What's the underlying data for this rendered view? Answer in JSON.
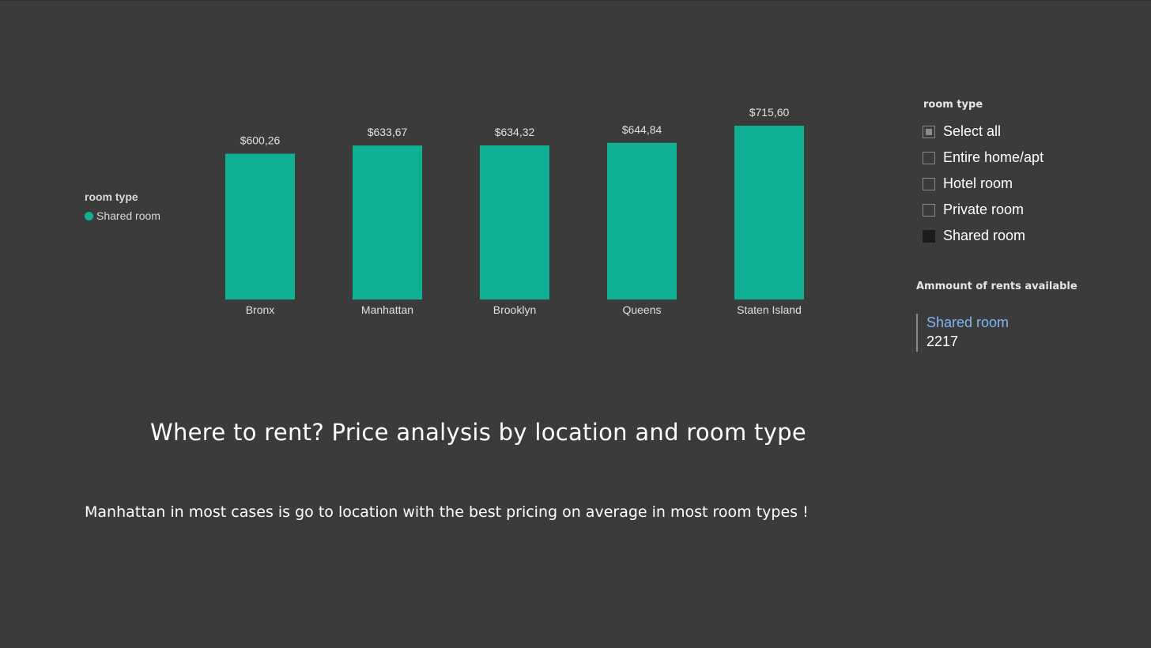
{
  "report": {
    "title": "Where to rent? Price analysis by location and room type",
    "note": "Manhattan in most cases is go to location with the best pricing on average in most room types !"
  },
  "legend": {
    "title": "room type",
    "item": "Shared room",
    "color": "#10b095"
  },
  "chart_data": {
    "type": "bar",
    "categories": [
      "Bronx",
      "Manhattan",
      "Brooklyn",
      "Queens",
      "Staten Island"
    ],
    "series": [
      {
        "name": "Shared room",
        "values": [
          600.26,
          633.67,
          634.32,
          644.84,
          715.6
        ],
        "labels": [
          "$600,26",
          "$633,67",
          "$634,32",
          "$644,84",
          "$715,60"
        ],
        "color": "#10b095"
      }
    ],
    "grid": false,
    "legend_position": "left"
  },
  "slicer": {
    "title": "room type",
    "options": [
      {
        "label": "Select all",
        "state": "partial"
      },
      {
        "label": "Entire home/apt",
        "state": "unchecked"
      },
      {
        "label": "Hotel room",
        "state": "unchecked"
      },
      {
        "label": "Private room",
        "state": "unchecked"
      },
      {
        "label": "Shared room",
        "state": "checked"
      }
    ]
  },
  "card": {
    "title": "Ammount of rents available",
    "label": "Shared room",
    "value": "2217"
  },
  "colors": {
    "background": "#3b3b3b",
    "bar": "#10b095",
    "card_label": "#7fb6f0"
  }
}
